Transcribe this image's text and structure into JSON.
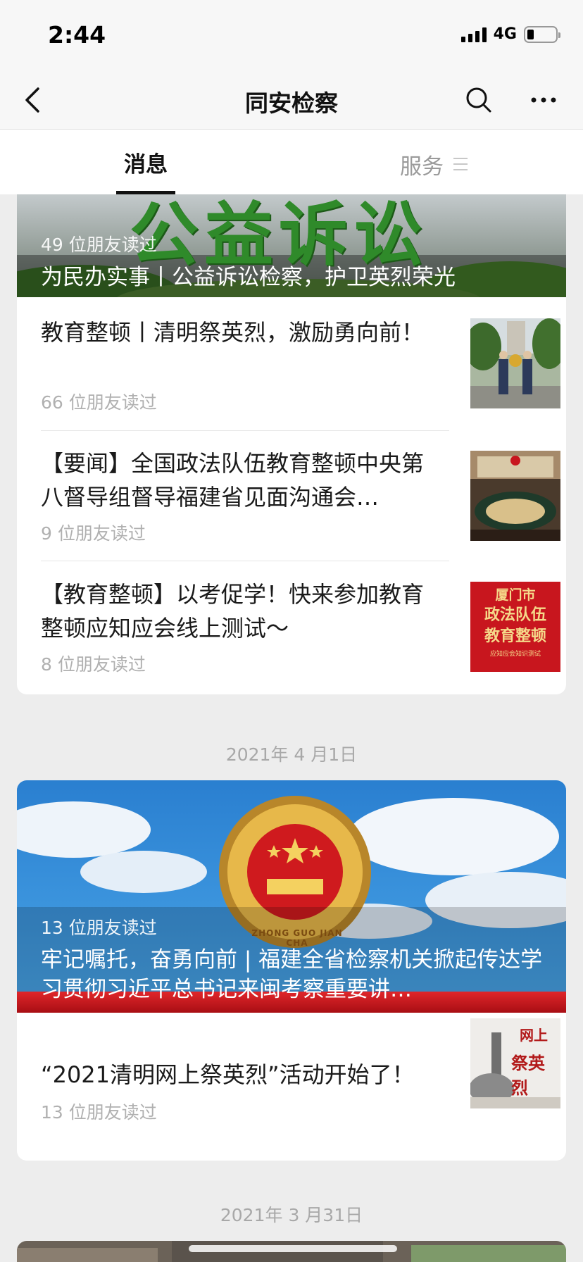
{
  "status_bar": {
    "time": "2:44",
    "network": "4G"
  },
  "header": {
    "title": "同安检察"
  },
  "tabs": {
    "messages": "消息",
    "services": "服务"
  },
  "feed": {
    "card1": {
      "cover_art_text": "公益诉讼",
      "cover_reads": "49 位朋友读过",
      "cover_title": "为民办实事丨公益诉讼检察，护卫英烈荣光",
      "items": [
        {
          "title": "教育整顿丨清明祭英烈，激励勇向前！",
          "reads": "66 位朋友读过"
        },
        {
          "title": "【要闻】全国政法队伍教育整顿中央第八督导组督导福建省见面沟通会…",
          "reads": "9 位朋友读过"
        },
        {
          "title": "【教育整顿】以考促学！快来参加教育整顿应知应会线上测试～",
          "reads": "8 位朋友读过",
          "thumb_text": [
            "厦门市",
            "政法队伍",
            "教育整顿"
          ],
          "thumb_caption": "应知应会知识测试"
        }
      ]
    },
    "date1": "2021年 4 月1日",
    "card2": {
      "cover_reads": "13 位朋友读过",
      "cover_title": "牢记嘱托，奋勇向前 | 福建全省检察机关掀起传达学习贯彻习近平总书记来闽考察重要讲…",
      "badge_text": "ZHONG GUO JIAN CHA",
      "items": [
        {
          "title": "“2021清明网上祭英烈”活动开始了！",
          "reads": "13 位朋友读过",
          "thumb_text": [
            "网上",
            "祭英烈"
          ]
        }
      ]
    },
    "date2": "2021年 3 月31日"
  },
  "colors": {
    "background": "#ededed",
    "card": "#ffffff",
    "muted": "#b0b0b0",
    "banner_red": "#c8161e"
  }
}
